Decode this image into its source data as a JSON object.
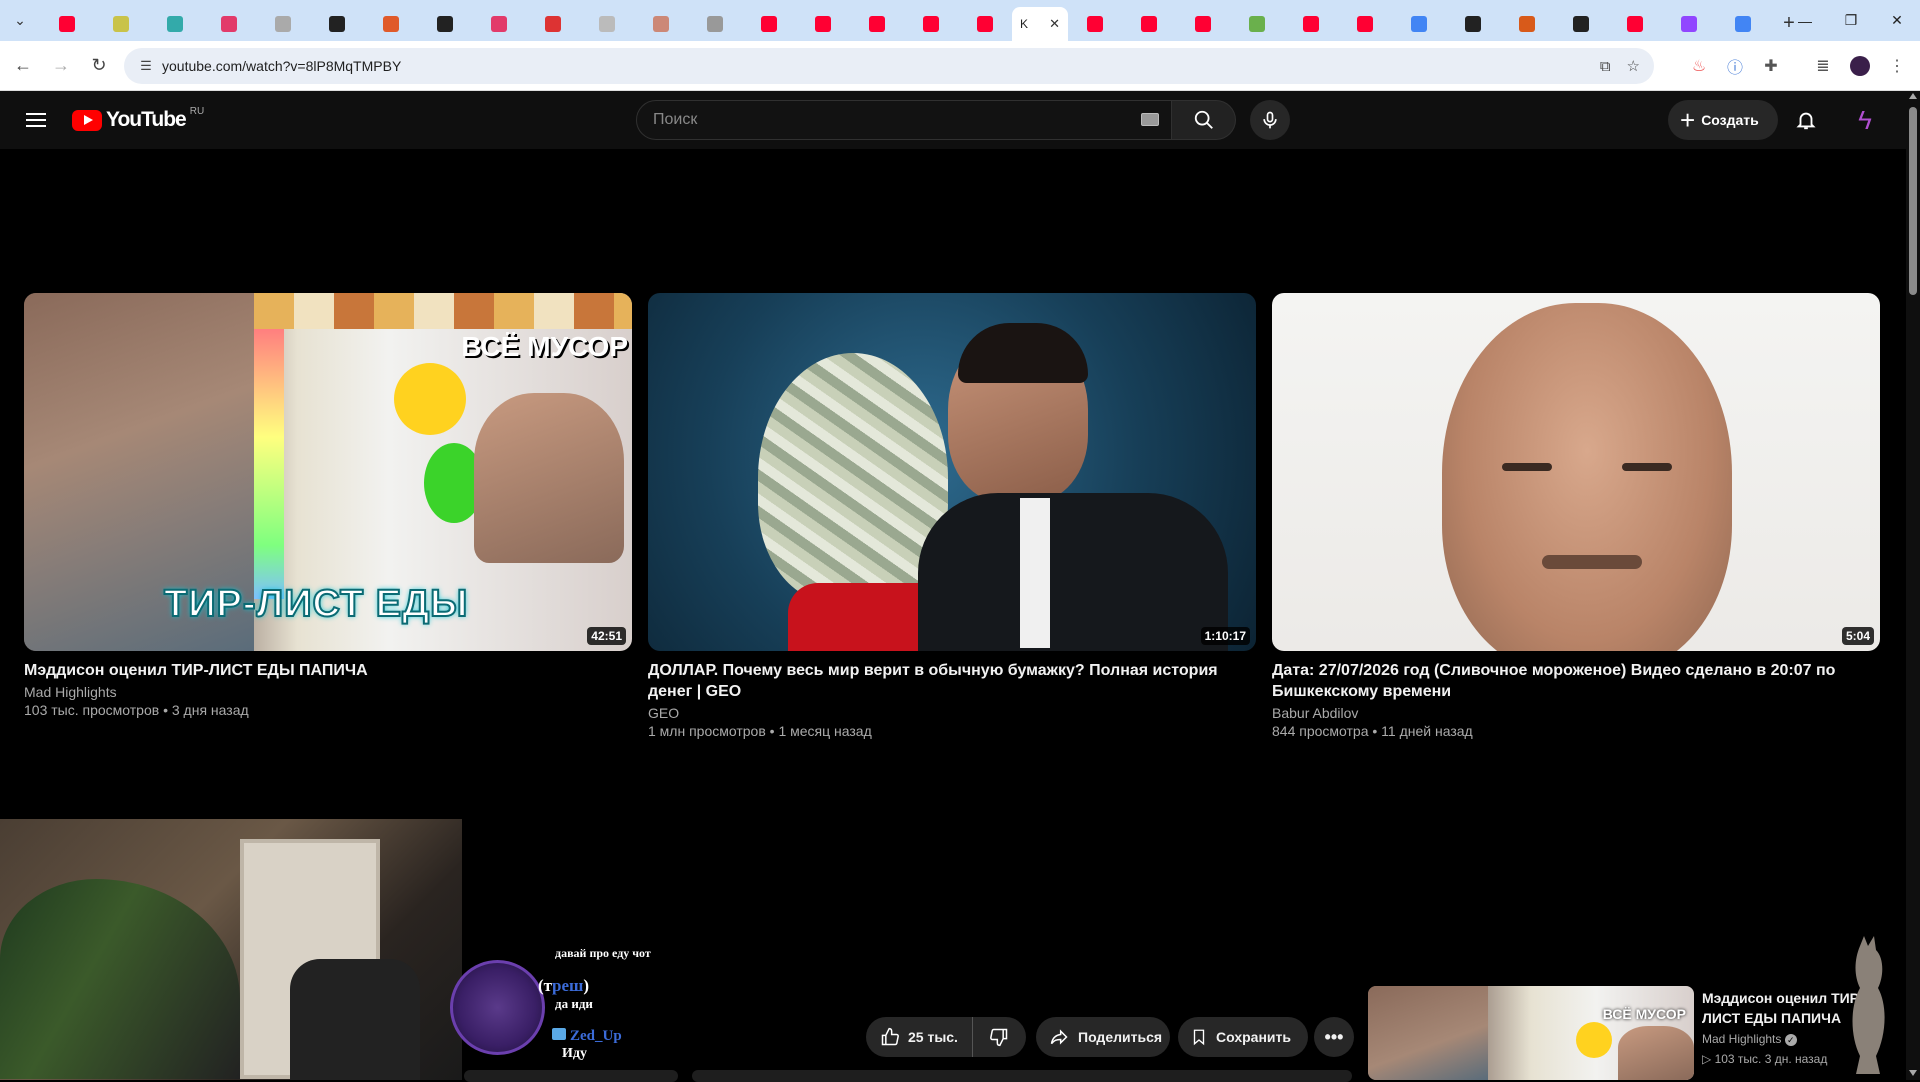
{
  "browser": {
    "active_tab_title": "K",
    "url": "youtube.com/watch?v=8lP8MqTMPBY",
    "tab_favicons": [
      {
        "name": "youtube",
        "color": "#ff0033"
      },
      {
        "name": "chrome-web",
        "color": "#c9c34a"
      },
      {
        "name": "colorwheel",
        "color": "#3aa"
      },
      {
        "name": "tv-app",
        "color": "#e23a6a"
      },
      {
        "name": "grey-site",
        "color": "#aaa"
      },
      {
        "name": "letter-a",
        "color": "#222"
      },
      {
        "name": "stripe-s",
        "color": "#e05a2a"
      },
      {
        "name": "anchor",
        "color": "#222"
      },
      {
        "name": "tv-app-2",
        "color": "#e23a6a"
      },
      {
        "name": "red-ball",
        "color": "#d33"
      },
      {
        "name": "grey-circle",
        "color": "#bbb"
      },
      {
        "name": "person",
        "color": "#c87"
      },
      {
        "name": "person-2",
        "color": "#999"
      },
      {
        "name": "youtube",
        "color": "#ff0033"
      },
      {
        "name": "youtube",
        "color": "#ff0033"
      },
      {
        "name": "youtube",
        "color": "#ff0033"
      },
      {
        "name": "youtube",
        "color": "#ff0033"
      },
      {
        "name": "youtube",
        "color": "#ff0033"
      }
    ],
    "tab_favicons_right": [
      {
        "name": "youtube",
        "color": "#ff0033"
      },
      {
        "name": "youtube",
        "color": "#ff0033"
      },
      {
        "name": "youtube",
        "color": "#ff0033"
      },
      {
        "name": "sheets-b",
        "color": "#6ab04c"
      },
      {
        "name": "youtube",
        "color": "#ff0033"
      },
      {
        "name": "youtube",
        "color": "#ff0033"
      },
      {
        "name": "google-g",
        "color": "#4285f4"
      },
      {
        "name": "r-app",
        "color": "#222"
      },
      {
        "name": "k-app",
        "color": "#d85a1a"
      },
      {
        "name": "r-app",
        "color": "#222"
      },
      {
        "name": "youtube",
        "color": "#ff0033"
      },
      {
        "name": "twitch",
        "color": "#9146ff"
      },
      {
        "name": "google-g",
        "color": "#4285f4"
      }
    ]
  },
  "youtube": {
    "logo_text": "YouTube",
    "region": "RU",
    "search_placeholder": "Поиск",
    "create_label": "Создать"
  },
  "videos": [
    {
      "title": "Мэддисон оценил ТИР-ЛИСТ ЕДЫ ПАПИЧА",
      "channel": "Mad Highlights",
      "meta": "103 тыс. просмотров • 3 дня назад",
      "duration": "42:51",
      "thumb_text_top": "ВСЁ МУСОР",
      "thumb_text_bottom": "ТИР-ЛИСТ ЕДЫ"
    },
    {
      "title": "ДОЛЛАР. Почему весь мир верит в обычную бумажку? Полная история денег | GEO",
      "channel": "GEO",
      "meta": "1 млн просмотров • 1 месяц назад",
      "duration": "1:10:17"
    },
    {
      "title": "Дата: 27/07/2026 год (Сливочное мороженое) Видео сделано в 20:07 по Бишкекскому времени",
      "channel": "Babur Abdilov",
      "meta": "844 просмотра • 11 дней назад",
      "duration": "5:04"
    }
  ],
  "stream_chat": {
    "top_message": "давай про еду чот",
    "user1_name_prefix": "(т",
    "user1_name_link": "реш",
    "user1_name_suffix": ")",
    "user1_message": "да иди",
    "user2_name": "Zed_Up",
    "user2_message": "Иду"
  },
  "actions": {
    "likes": "25 тыс.",
    "share_label": "Поделиться",
    "save_label": "Сохранить"
  },
  "recommended": {
    "title": "Мэддисон оценил ТИР-ЛИСТ ЕДЫ ПАПИЧА",
    "channel": "Mad Highlights",
    "meta": "▷ 103 тыс.   3 дн. назад",
    "thumb_label": "ВСЁ МУСОР"
  }
}
